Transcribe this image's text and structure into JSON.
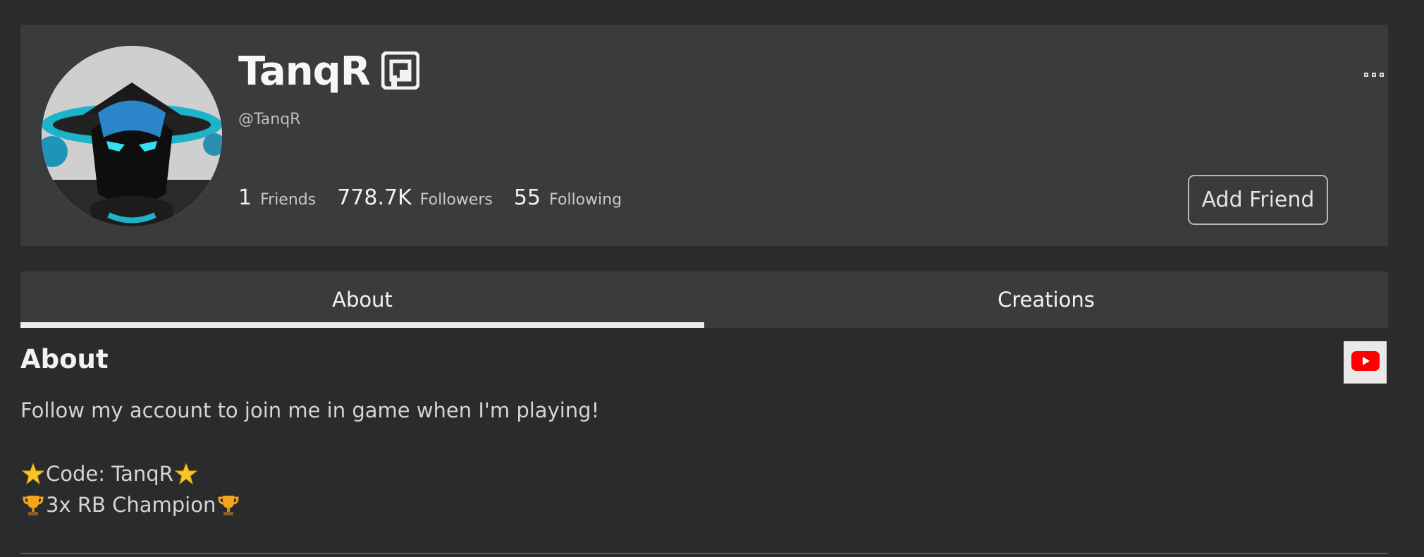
{
  "profile": {
    "display_name": "TanqR",
    "username": "@TanqR",
    "badge_icon": "verified-badge-icon",
    "stats": [
      {
        "value": "1",
        "label": "Friends"
      },
      {
        "value": "778.7K",
        "label": "Followers"
      },
      {
        "value": "55",
        "label": "Following"
      }
    ],
    "add_friend_label": "Add Friend",
    "more_icon": "more-options-icon"
  },
  "tabs": [
    {
      "label": "About",
      "active": true
    },
    {
      "label": "Creations",
      "active": false
    }
  ],
  "about": {
    "title": "About",
    "lines": [
      "Follow my account to join me in game when I'm playing!",
      "Code: TanqR",
      "3x RB Champion"
    ],
    "social_icon": "youtube-icon"
  },
  "colors": {
    "background": "#2a2b2d",
    "card": "#393b3d",
    "accent_youtube": "#ff0000"
  }
}
